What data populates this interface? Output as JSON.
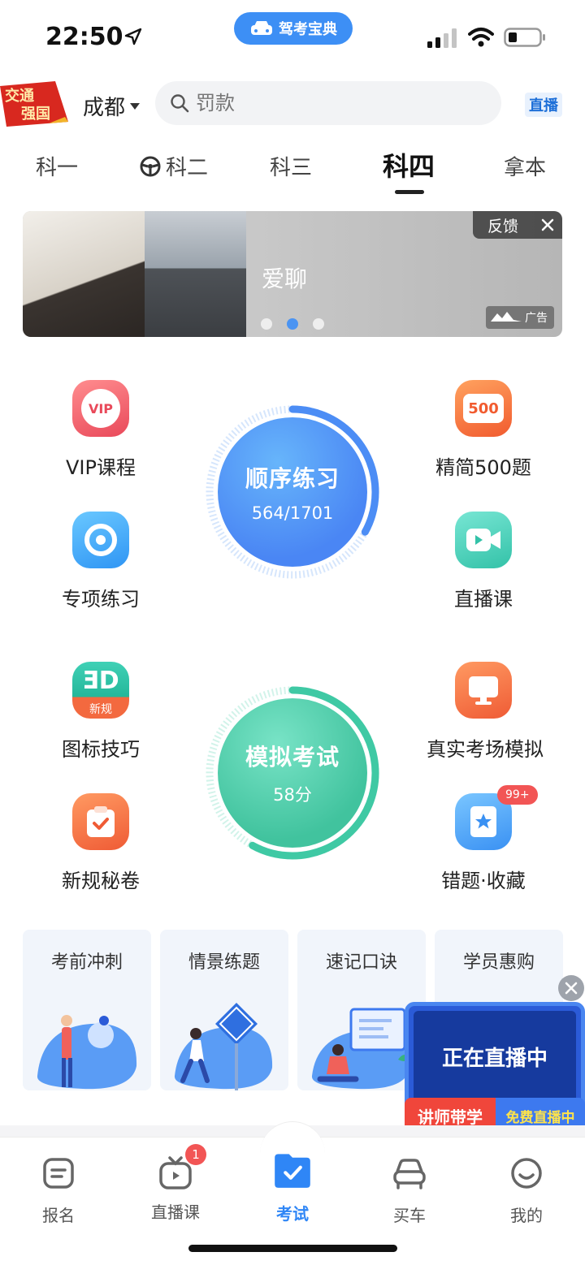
{
  "status_bar": {
    "time": "22:50",
    "app_pill": "驾考宝典"
  },
  "header": {
    "badge_text_1": "交通",
    "badge_text_2": "强国",
    "city": "成都",
    "search_placeholder": "罚款",
    "live_tag": "直播"
  },
  "tabs": [
    {
      "label": "科一"
    },
    {
      "label": "科二"
    },
    {
      "label": "科三"
    },
    {
      "label": "科四",
      "active": true
    },
    {
      "label": "拿本"
    }
  ],
  "banner": {
    "text": "爱聊",
    "feedback": "反馈",
    "ad_label": "广告",
    "active_dot": 1,
    "dot_count": 3
  },
  "practice": {
    "title": "顺序练习",
    "progress": "564/1701",
    "progress_fraction": 0.33
  },
  "exam": {
    "title": "模拟考试",
    "score": "58分",
    "progress_fraction": 0.58
  },
  "features": {
    "vip": {
      "label": "VIP课程",
      "icon_text": "VIP"
    },
    "jingjian": {
      "label": "精简500题",
      "icon_text": "500"
    },
    "zhuanxiang": {
      "label": "专项练习"
    },
    "zhibo": {
      "label": "直播课"
    },
    "tubiao": {
      "label": "图标技巧",
      "icon_text": "新规"
    },
    "zhenshi": {
      "label": "真实考场模拟"
    },
    "mijuan": {
      "label": "新规秘卷"
    },
    "cuoti": {
      "label": "错题·收藏",
      "badge": "99+"
    }
  },
  "tiles": [
    {
      "title": "考前冲刺"
    },
    {
      "title": "情景练题"
    },
    {
      "title": "速记口诀"
    },
    {
      "title": "学员惠购"
    }
  ],
  "live_float": {
    "title": "正在直播中",
    "ribbon_left": "讲师带学",
    "ribbon_right": "免费直播中"
  },
  "bottom_nav": [
    {
      "label": "报名",
      "icon": "note-icon"
    },
    {
      "label": "直播课",
      "icon": "tv-icon",
      "badge": "1"
    },
    {
      "label": "考试",
      "icon": "folder-check-icon",
      "active": true
    },
    {
      "label": "买车",
      "icon": "car-icon"
    },
    {
      "label": "我的",
      "icon": "smile-icon"
    }
  ],
  "colors": {
    "accent_blue": "#2f86f6",
    "practice_blue": "#4c8df5",
    "exam_green": "#4fcfb0",
    "vip_red": "#f0616b",
    "orange": "#f3693f"
  }
}
